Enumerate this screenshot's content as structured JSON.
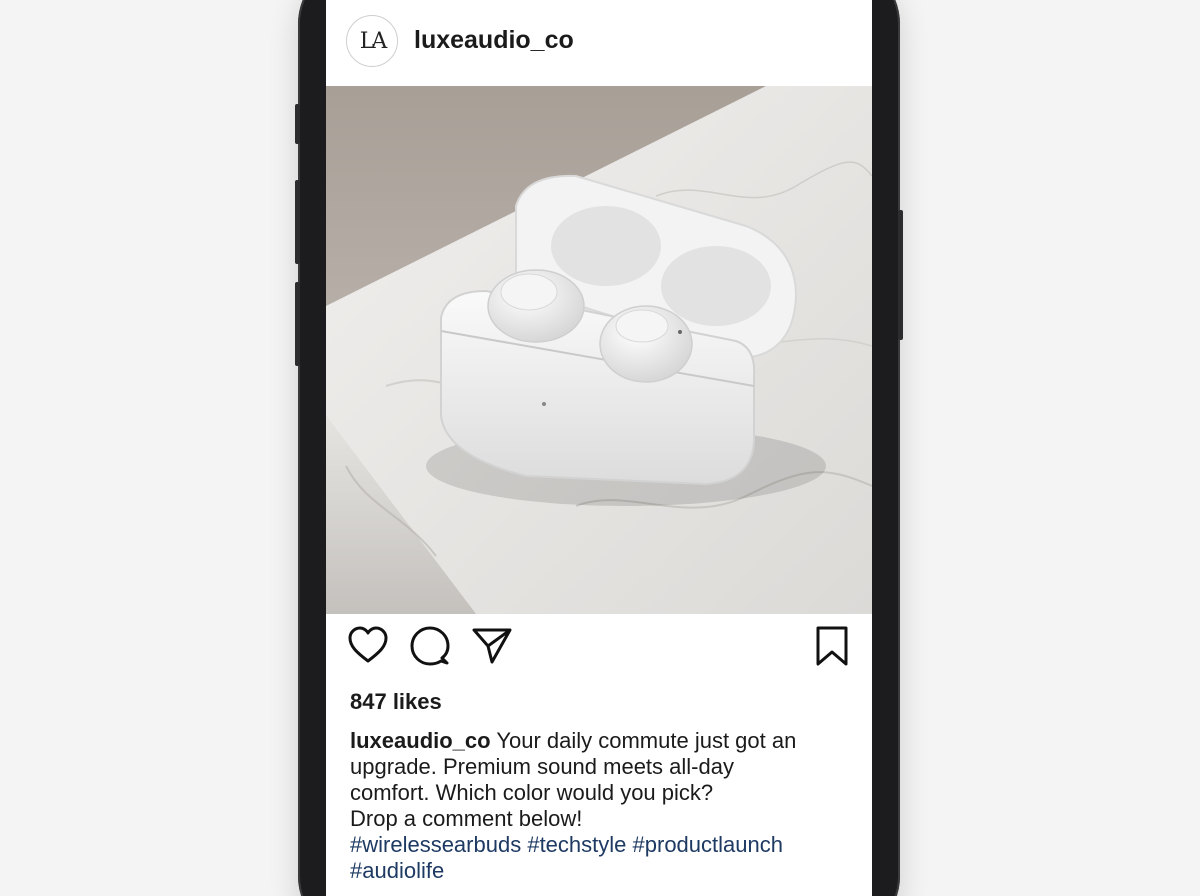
{
  "post": {
    "avatar_initials": "LA",
    "username": "luxeaudio_co",
    "likes": "847 likes",
    "caption_user": "luxeaudio_co",
    "caption_lines": [
      "Your daily commute just got an",
      "upgrade. Premium sound meets all-day",
      "comfort. Which color would you pick?",
      "Drop a comment below!"
    ],
    "hashtags": [
      "#wirelessearbuds",
      "#techstyle",
      "#productlaunch",
      "#audiolife"
    ]
  },
  "actions": {
    "icons": [
      "heart-icon",
      "comment-icon",
      "share-icon",
      "bookmark-icon"
    ]
  },
  "colors": {
    "hashtag": "#1e3a63",
    "text": "#1b1b1b",
    "frame": "#1c1c1e"
  }
}
